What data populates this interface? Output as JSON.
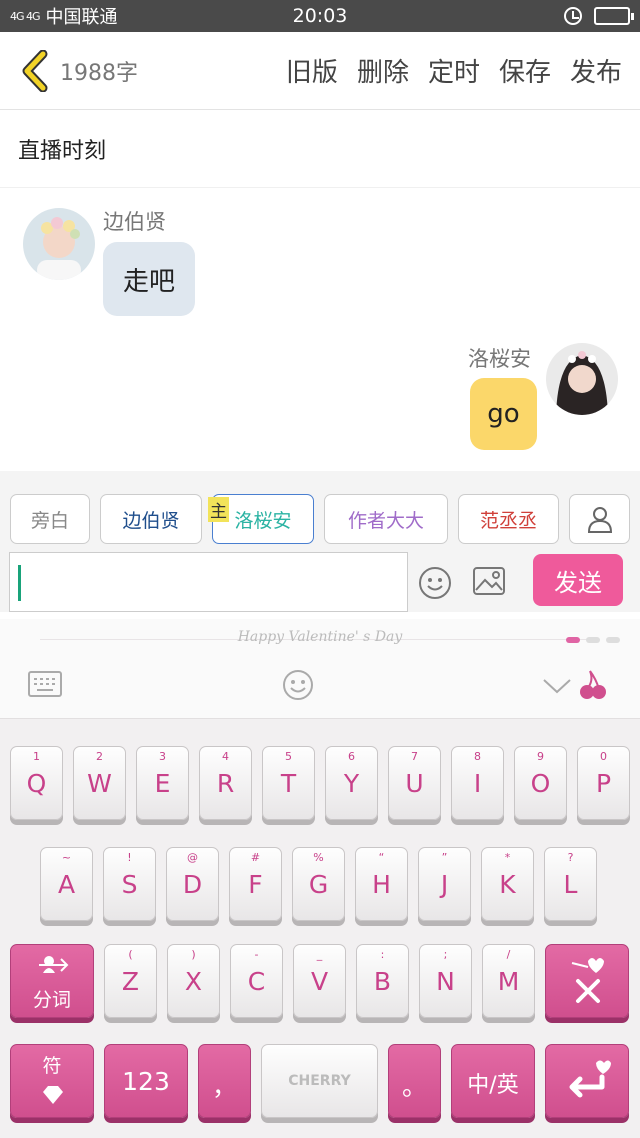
{
  "status": {
    "carrier": "中国联通",
    "signal": "4G 4G",
    "time": "20:03"
  },
  "header": {
    "word_count": "1988字",
    "actions": [
      "旧版",
      "删除",
      "定时",
      "保存",
      "发布"
    ]
  },
  "title": "直播时刻",
  "messages": [
    {
      "side": "left",
      "name": "边伯贤",
      "text": "走吧"
    },
    {
      "side": "right",
      "name": "洛桜安",
      "text": "go"
    }
  ],
  "roles": [
    {
      "label": "旁白",
      "color": "#888888"
    },
    {
      "label": "边伯贤",
      "color": "#1f4e8c"
    },
    {
      "label": "洛桜安",
      "color": "#2bb3a3"
    },
    {
      "label": "作者大大",
      "color": "#a06cc9"
    },
    {
      "label": "范丞丞",
      "color": "#d0403a"
    }
  ],
  "main_tag": "主",
  "input": {
    "value": "",
    "send_label": "发送"
  },
  "keyboard": {
    "theme_text": "Happy Valentine' s Day",
    "row1": [
      [
        "1",
        "Q"
      ],
      [
        "2",
        "W"
      ],
      [
        "3",
        "E"
      ],
      [
        "4",
        "R"
      ],
      [
        "5",
        "T"
      ],
      [
        "6",
        "Y"
      ],
      [
        "7",
        "U"
      ],
      [
        "8",
        "I"
      ],
      [
        "9",
        "O"
      ],
      [
        "0",
        "P"
      ]
    ],
    "row2": [
      [
        "~",
        "A"
      ],
      [
        "!",
        "S"
      ],
      [
        "@",
        "D"
      ],
      [
        "#",
        "F"
      ],
      [
        "%",
        "G"
      ],
      [
        "“",
        "H"
      ],
      [
        "”",
        "J"
      ],
      [
        "*",
        "K"
      ],
      [
        "?",
        "L"
      ]
    ],
    "row3": [
      [
        "(",
        "Z"
      ],
      [
        ")",
        "X"
      ],
      [
        "-",
        "C"
      ],
      [
        "_",
        "V"
      ],
      [
        ":",
        "B"
      ],
      [
        ";",
        "N"
      ],
      [
        "/",
        "M"
      ]
    ],
    "fenci": "分词",
    "fu": "符",
    "num": "123",
    "comma": "，",
    "space": "CHERRY",
    "period": "。",
    "lang": "中/英"
  }
}
